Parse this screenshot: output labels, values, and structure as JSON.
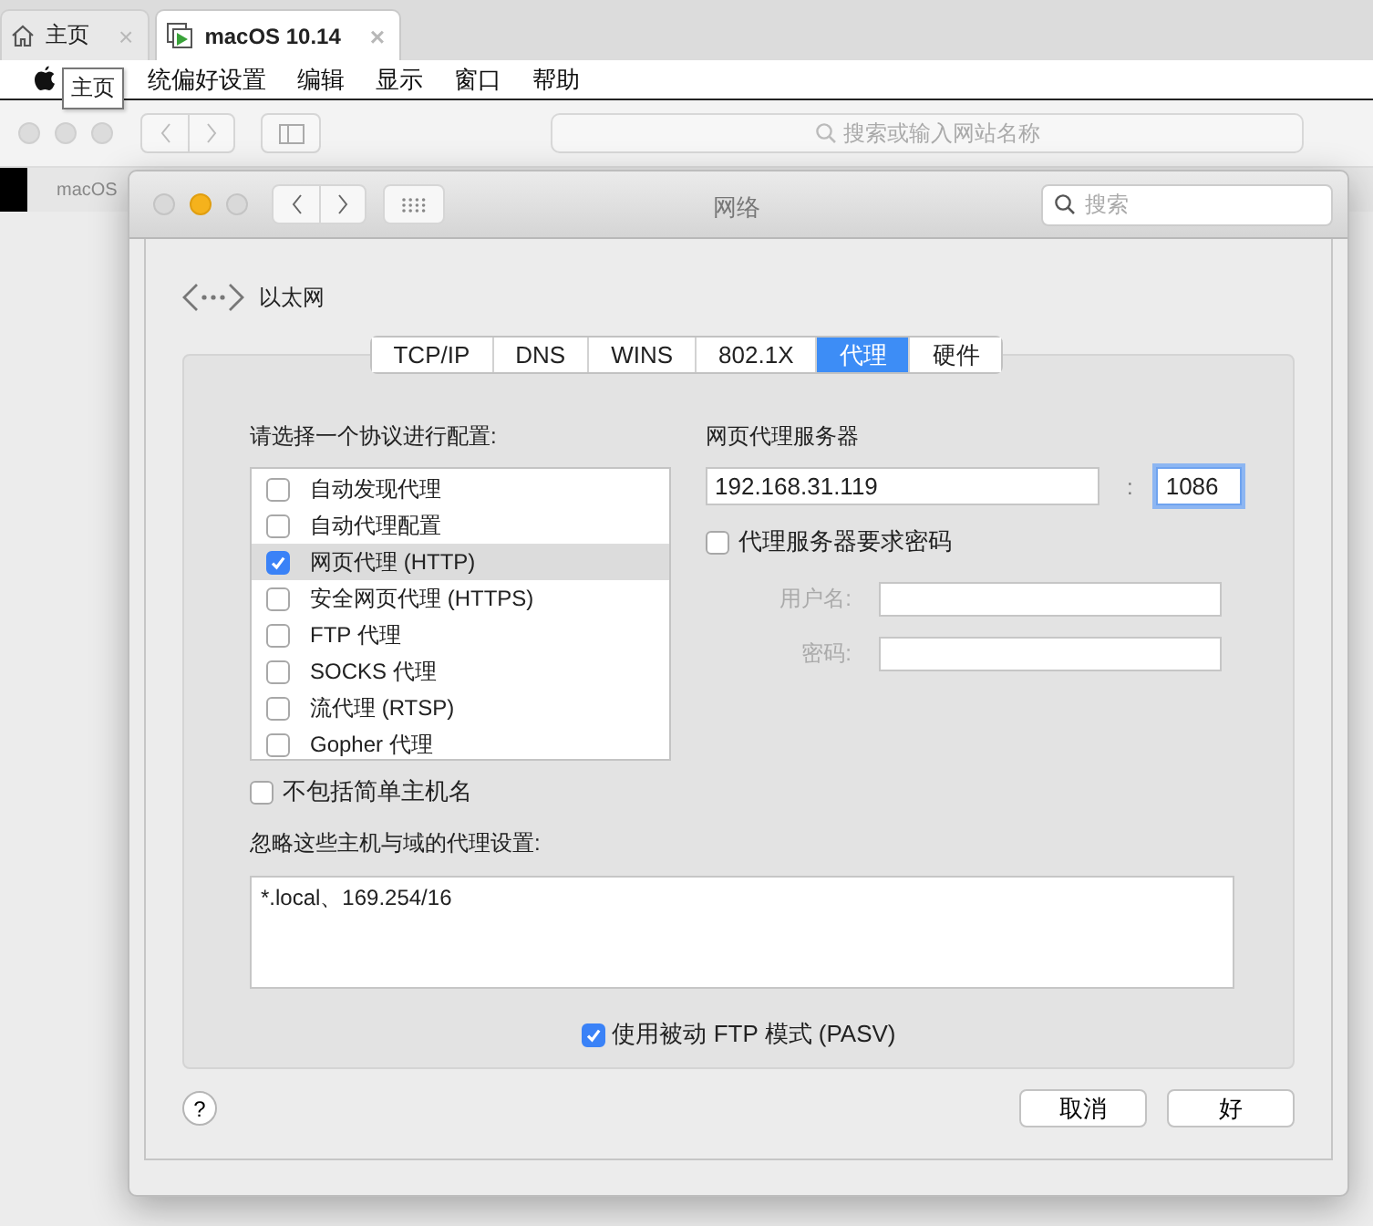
{
  "host_tabs": [
    {
      "label": "主页",
      "kind": "home",
      "close": "×",
      "selected": false
    },
    {
      "label": "macOS 10.14",
      "kind": "vm",
      "close": "×",
      "selected": true
    }
  ],
  "tooltip": "主页",
  "menu_bar": {
    "items": [
      "统偏好设置",
      "编辑",
      "显示",
      "窗口",
      "帮助"
    ]
  },
  "browser": {
    "address_placeholder": "搜索或输入网站名称",
    "page_tab": "macOS"
  },
  "window": {
    "title": "网络",
    "search_placeholder": "搜索"
  },
  "service": "以太网",
  "tabs": [
    {
      "label": "TCP/IP",
      "selected": false
    },
    {
      "label": "DNS",
      "selected": false
    },
    {
      "label": "WINS",
      "selected": false
    },
    {
      "label": "802.1X",
      "selected": false
    },
    {
      "label": "代理",
      "selected": true
    },
    {
      "label": "硬件",
      "selected": false
    }
  ],
  "protocols": {
    "label": "请选择一个协议进行配置:",
    "items": [
      {
        "label": "自动发现代理",
        "checked": false,
        "selected": false
      },
      {
        "label": "自动代理配置",
        "checked": false,
        "selected": false
      },
      {
        "label": "网页代理 (HTTP)",
        "checked": true,
        "selected": true
      },
      {
        "label": "安全网页代理 (HTTPS)",
        "checked": false,
        "selected": false
      },
      {
        "label": "FTP 代理",
        "checked": false,
        "selected": false
      },
      {
        "label": "SOCKS 代理",
        "checked": false,
        "selected": false
      },
      {
        "label": "流代理 (RTSP)",
        "checked": false,
        "selected": false
      },
      {
        "label": "Gopher 代理",
        "checked": false,
        "selected": false
      }
    ]
  },
  "server": {
    "label": "网页代理服务器",
    "host": "192.168.31.119",
    "separator": ":",
    "port": "1086",
    "requires_password": {
      "label": "代理服务器要求密码",
      "checked": false
    },
    "credentials": [
      {
        "label": "用户名:",
        "disabled": true
      },
      {
        "label": "密码:",
        "disabled": true
      }
    ]
  },
  "exclude_simple": {
    "label": "不包括简单主机名",
    "checked": false
  },
  "bypass": {
    "label": "忽略这些主机与域的代理设置:",
    "value": "*.local、169.254/16"
  },
  "pasv": {
    "label": "使用被动 FTP 模式 (PASV)",
    "checked": true
  },
  "help": "?",
  "buttons": [
    "取消",
    "好"
  ]
}
